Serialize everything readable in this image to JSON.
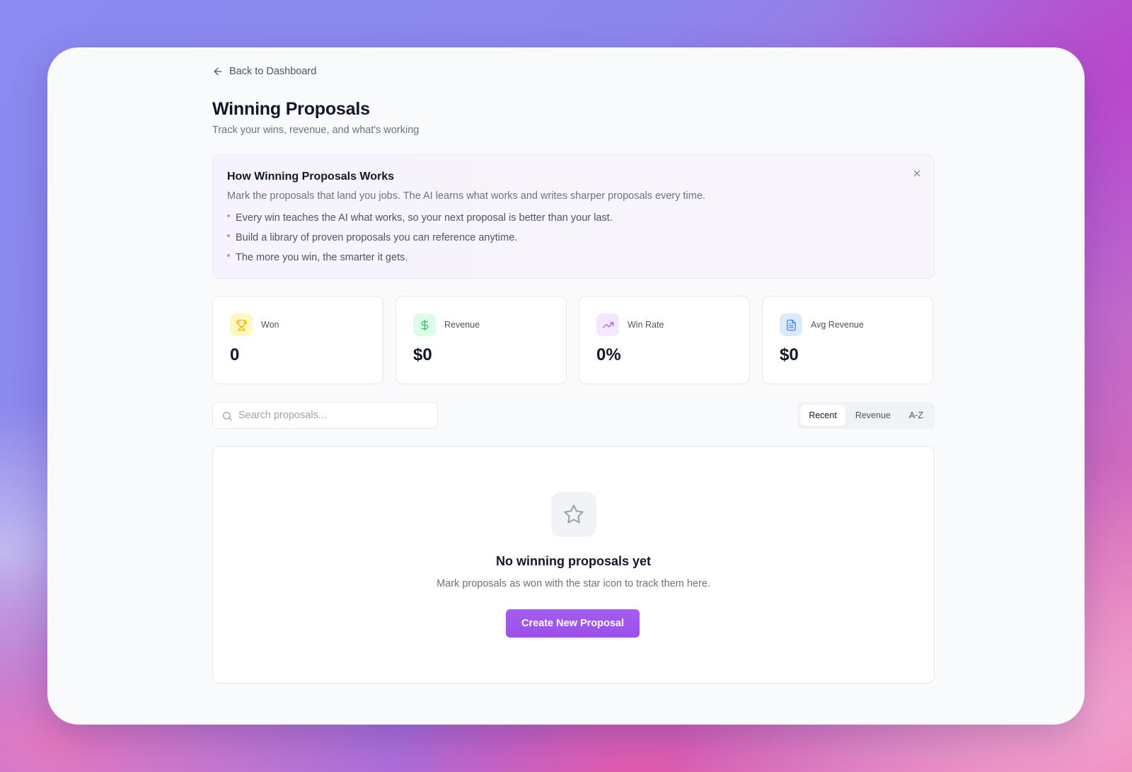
{
  "nav": {
    "back_label": "Back to Dashboard"
  },
  "header": {
    "title": "Winning Proposals",
    "subtitle": "Track your wins, revenue, and what's working"
  },
  "info": {
    "title": "How Winning Proposals Works",
    "description": "Mark the proposals that land you jobs. The AI learns what works and writes sharper proposals every time.",
    "bullets": [
      "Every win teaches the AI what works, so your next proposal is better than your last.",
      "Build a library of proven proposals you can reference anytime.",
      "The more you win, the smarter it gets."
    ]
  },
  "stats": [
    {
      "label": "Won",
      "value": "0",
      "icon": "trophy-icon",
      "color": "#eab308",
      "bg": "#fef9c3"
    },
    {
      "label": "Revenue",
      "value": "$0",
      "icon": "dollar-icon",
      "color": "#22c55e",
      "bg": "#dcfce7"
    },
    {
      "label": "Win Rate",
      "value": "0%",
      "icon": "trending-up-icon",
      "color": "#a855f7",
      "bg": "#f3e8ff"
    },
    {
      "label": "Avg Revenue",
      "value": "$0",
      "icon": "document-icon",
      "color": "#3b82f6",
      "bg": "#dbeafe"
    }
  ],
  "search": {
    "placeholder": "Search proposals...",
    "value": ""
  },
  "sort": {
    "options": [
      "Recent",
      "Revenue",
      "A-Z"
    ],
    "active": "Recent"
  },
  "empty": {
    "title": "No winning proposals yet",
    "description": "Mark proposals as won with the star icon to track them here.",
    "button_label": "Create New Proposal"
  },
  "colors": {
    "accent": "#a259f0",
    "page_bg": "#f9fafb"
  }
}
